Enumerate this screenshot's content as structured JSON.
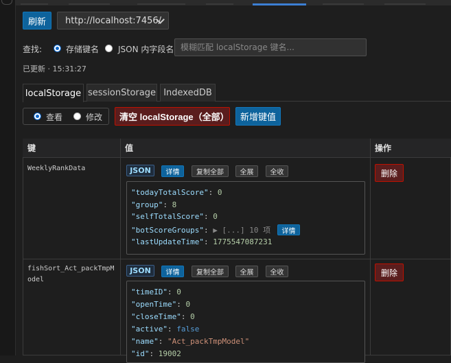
{
  "toolbar": {
    "refresh_label": "刷新",
    "url_value": "http://localhost:7456/"
  },
  "search": {
    "label": "查找:",
    "opt_key": "存储键名",
    "opt_json": "JSON 内字段名",
    "placeholder": "模糊匹配 localStorage 键名..."
  },
  "status": {
    "updated": "已更新 · 15:31:27"
  },
  "tabs": [
    {
      "label": "localStorage"
    },
    {
      "label": "sessionStorage"
    },
    {
      "label": "IndexedDB"
    }
  ],
  "mode": {
    "view": "查看",
    "edit": "修改"
  },
  "actions": {
    "clear": "清空 localStorage（全部）",
    "add": "新增键值"
  },
  "table": {
    "col_key": "键",
    "col_value": "值",
    "col_ops": "操作"
  },
  "mini_labels": {
    "json": "JSON",
    "detail": "详情",
    "copy_all": "复制全部",
    "expand_all": "全展",
    "collapse_all": "全收",
    "delete": "删除"
  },
  "rows": [
    {
      "key": "WeeklyRankData",
      "lines": [
        {
          "k": "todayTotalScore",
          "v": "0"
        },
        {
          "k": "group",
          "v": "8"
        },
        {
          "k": "selfTotalScore",
          "v": "0"
        },
        {
          "k": "botScoreGroups",
          "collapsed": "▶ [...] 10 项",
          "btn": "详情"
        },
        {
          "k": "lastUpdateTime",
          "v": "1775547087231"
        }
      ]
    },
    {
      "key": "fishSort_Act_packTmpModel",
      "lines": [
        {
          "k": "timeID",
          "v": "0"
        },
        {
          "k": "openTime",
          "v": "0"
        },
        {
          "k": "closeTime",
          "v": "0"
        },
        {
          "k": "active",
          "v": "false"
        },
        {
          "k": "name",
          "v": "\"Act_packTmpModel\""
        },
        {
          "k": "id",
          "v": "19002"
        }
      ]
    }
  ],
  "colors": {
    "primary": "#0e639c",
    "danger_bg": "#5a1d1d",
    "danger_border": "#be1100",
    "bg": "#1e1e1e"
  }
}
